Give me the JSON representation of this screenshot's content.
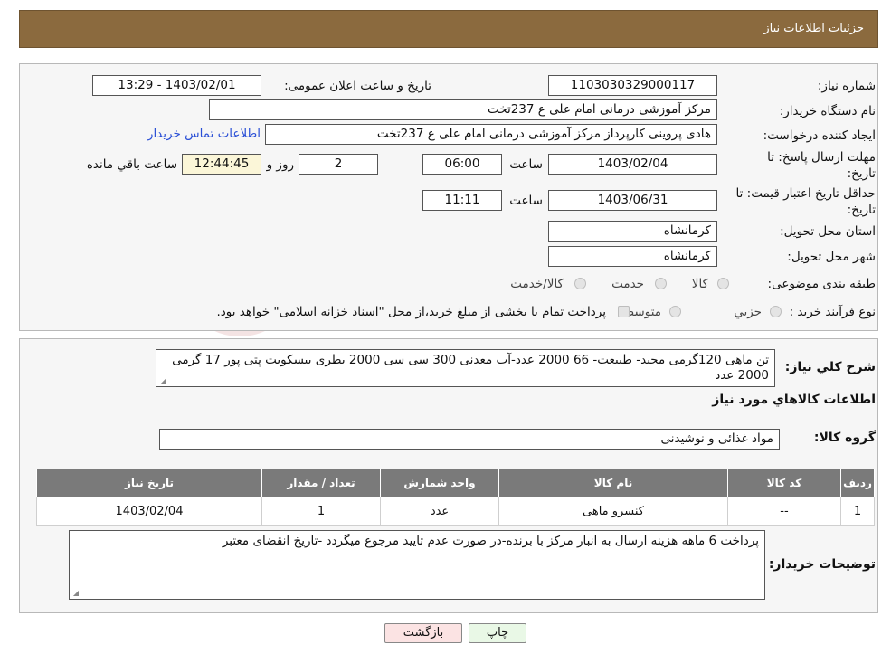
{
  "header": {
    "title": "جزئیات اطلاعات نیاز"
  },
  "fields": {
    "need_number_label": "شماره نیاز:",
    "need_number": "1103030329000117",
    "announce_label": "تاریخ و ساعت اعلان عمومی:",
    "announce_value": "1403/02/01 - 13:29",
    "buyer_org_label": "نام دستگاه خریدار:",
    "buyer_org": "مرکز آموزشی درمانی امام علی ع 237تخت",
    "creator_label": "ایجاد کننده درخواست:",
    "creator": "هادی پروینی کارپرداز  مرکز آموزشی درمانی امام علی ع 237تخت",
    "contact_link": "اطلاعات تماس خریدار",
    "deadline_label_1": "مهلت ارسال پاسخ: تا",
    "deadline_label_2": "تاریخ:",
    "deadline_date": "1403/02/04",
    "time_label": "ساعت",
    "deadline_time": "06:00",
    "days": "2",
    "days_label": "روز و",
    "remaining": "12:44:45",
    "remaining_label": "ساعت باقي مانده",
    "validity_label_1": "حداقل تاریخ اعتبار قیمت: تا",
    "validity_label_2": "تاریخ:",
    "validity_date": "1403/06/31",
    "validity_time": "11:11",
    "province_label": "استان محل تحویل:",
    "province": "کرمانشاه",
    "city_label": "شهر محل تحویل:",
    "city": "کرمانشاه",
    "category_label": "طبقه بندی موضوعی:",
    "cat_goods": "کالا",
    "cat_service": "خدمت",
    "cat_goods_service": "کالا/خدمت",
    "process_label": "نوع فرآیند خرید :",
    "proc_minor": "جزیي",
    "proc_medium": "متوسط",
    "proc_note": "پرداخت تمام یا بخشی از مبلغ خرید،از محل \"اسناد خزانه اسلامی\" خواهد بود."
  },
  "details": {
    "desc_label": "شرح کلي نياز:",
    "desc": "تن ماهی 120گرمی مجید- طبیعت- 66    2000 عدد-آب معدنی 300 سی سی 2000 بطری بیسکویت پتی پور 17 گرمی 2000 عدد",
    "goods_info_title": "اطلاعات کالاهاي مورد نياز",
    "group_label": "گروه کالا:",
    "group": "مواد غذائی و نوشیدنی",
    "table": {
      "headers": [
        "رديف",
        "کد کالا",
        "نام کالا",
        "واحد شمارش",
        "تعداد / مقدار",
        "تاريخ نياز"
      ],
      "rows": [
        [
          "1",
          "--",
          "کنسرو ماهی",
          "عدد",
          "1",
          "1403/02/04"
        ]
      ]
    },
    "buyer_notes_label": "توضیحات خریدار:",
    "buyer_notes": "پرداخت 6 ماهه هزینه ارسال به انبار مرکز با برنده-در صورت عدم تایید مرجوع میگردد -تاریخ انقضای معتبر"
  },
  "buttons": {
    "print": "چاپ",
    "back": "بازگشت"
  },
  "watermark": {
    "text": "AriaTender.neT"
  },
  "colors": {
    "header": "#8b6a3e",
    "remaining_bg": "#fbf6d8",
    "back_bg": "#fbe3e3",
    "print_bg": "#e9f8e6",
    "table_header": "#7a7a7a"
  }
}
